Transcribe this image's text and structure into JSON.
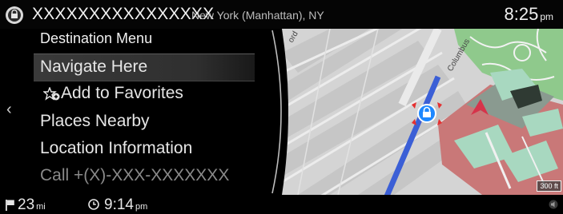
{
  "header": {
    "title": "XXXXXXXXXXXXXXXX",
    "location": "New York (Manhattan), NY",
    "time": "8:25",
    "ampm": "pm"
  },
  "menu": {
    "heading": "Destination Menu",
    "items": [
      {
        "label": "Navigate Here",
        "selected": true
      },
      {
        "label": "Add to Favorites",
        "icon": "star-add-icon"
      },
      {
        "label": "Places Nearby"
      },
      {
        "label": "Location Information"
      },
      {
        "label": "Call +(X)-XXX-XXXXXXX",
        "disabled": true
      }
    ]
  },
  "map": {
    "streets": [
      "Columbus",
      "ord"
    ],
    "scale": "300 ft",
    "colors": {
      "route": "#3b5fd6",
      "marker": "#1e88ff",
      "arrow": "#d6334a",
      "park": "#8fc98c",
      "building": "#c97878",
      "roof": "#a8d8c0"
    }
  },
  "status": {
    "distance": "23",
    "distance_unit": "mi",
    "eta": "9:14",
    "eta_unit": "pm"
  }
}
